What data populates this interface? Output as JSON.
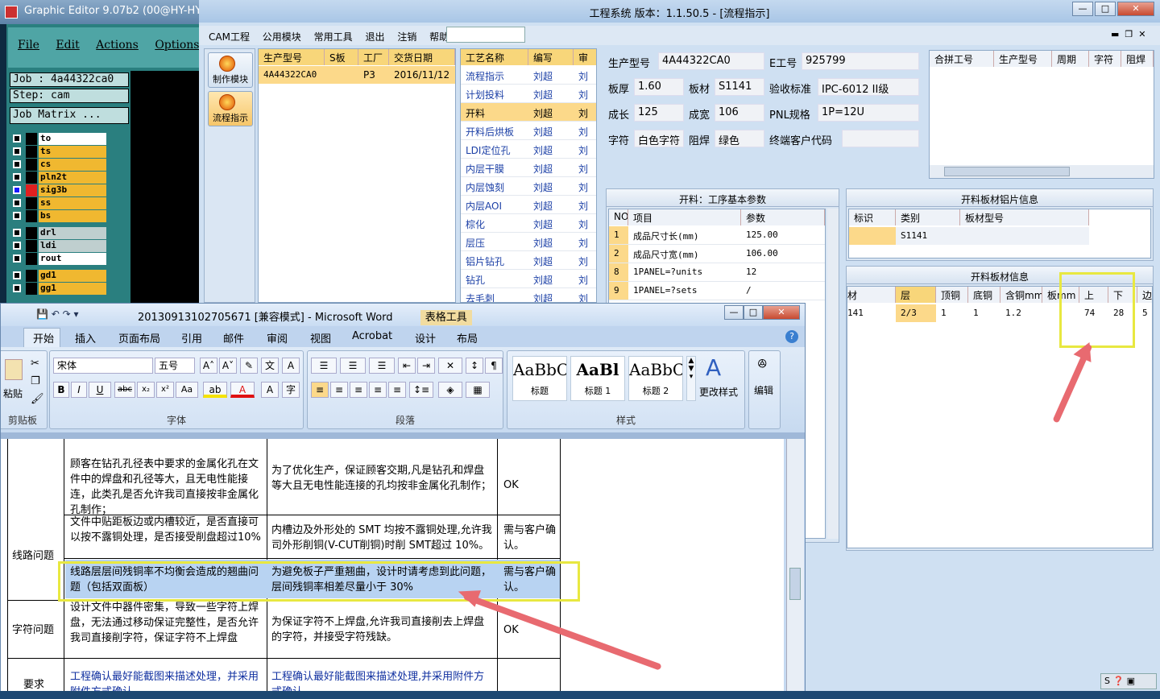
{
  "ge": {
    "title": "Graphic Editor 9.07b2 (00@HY-HYCA",
    "menu": [
      "File",
      "Edit",
      "Actions",
      "Options",
      "A"
    ],
    "job": "Job : 4a44322ca0",
    "step": "Step: cam",
    "matrix": "Job Matrix ...",
    "layers": [
      {
        "name": "to",
        "color": "#ffffff"
      },
      {
        "name": "ts",
        "color": "#f0b830"
      },
      {
        "name": "cs",
        "color": "#f0b830"
      },
      {
        "name": "pln2t",
        "color": "#f0b830"
      },
      {
        "name": "sig3b",
        "color": "#f0b830"
      },
      {
        "name": "ss",
        "color": "#f0b830"
      },
      {
        "name": "bs",
        "color": "#f0b830"
      },
      {
        "name": "drl",
        "color": "#bfcfcf"
      },
      {
        "name": "ldi",
        "color": "#bfcfcf"
      },
      {
        "name": "rout",
        "color": "#ffffff"
      },
      {
        "name": "gd1",
        "color": "#f0b830"
      },
      {
        "name": "gg1",
        "color": "#f0b830"
      }
    ]
  },
  "eng": {
    "title": "工程系统   版本：1.1.50.5 - [流程指示]",
    "menu": [
      "CAM工程",
      "公用模块",
      "常用工具",
      "退出",
      "注销",
      "帮助"
    ],
    "side": [
      "制作模块",
      "流程指示"
    ],
    "orders_headers": [
      "生产型号",
      "S板",
      "工厂",
      "交货日期"
    ],
    "orders_row": [
      "4A44322CA0",
      "",
      "P3",
      "2016/11/12"
    ],
    "process_headers": [
      "工艺名称",
      "编写",
      "审"
    ],
    "process_rows": [
      [
        "流程指示",
        "刘超",
        "刘"
      ],
      [
        "计划投料",
        "刘超",
        "刘"
      ],
      [
        "开料",
        "刘超",
        "刘"
      ],
      [
        "开料后烘板",
        "刘超",
        "刘"
      ],
      [
        "LDI定位孔",
        "刘超",
        "刘"
      ],
      [
        "内层干膜",
        "刘超",
        "刘"
      ],
      [
        "内层蚀刻",
        "刘超",
        "刘"
      ],
      [
        "内层AOI",
        "刘超",
        "刘"
      ],
      [
        "棕化",
        "刘超",
        "刘"
      ],
      [
        "层压",
        "刘超",
        "刘"
      ],
      [
        "铝片钻孔",
        "刘超",
        "刘"
      ],
      [
        "钻孔",
        "刘超",
        "刘"
      ],
      [
        "去毛刺",
        "刘超",
        "刘"
      ]
    ],
    "form": {
      "model_label": "生产型号",
      "model": "4A44322CA0",
      "eno_label": "E工号",
      "eno": "925799",
      "thick_label": "板厚",
      "thick": "1.60",
      "mat_label": "板材",
      "mat": "S1141",
      "std_label": "验收标准",
      "std": "IPC-6012 II级",
      "len_label": "成长",
      "len": "125",
      "wid_label": "成宽",
      "wid": "106",
      "pnl_label": "PNL规格",
      "pnl": "1P=12U",
      "char_label": "字符",
      "char": "白色字符",
      "mask_label": "阻焊",
      "mask": "绿色",
      "cust_label": "终端客户代码",
      "cust": ""
    },
    "merge_headers": [
      "合拼工号",
      "生产型号",
      "周期",
      "字符",
      "阻焊"
    ],
    "params_title": "开料：工序基本参数",
    "params_headers": [
      "NO",
      "项目",
      "参数"
    ],
    "params_rows": [
      [
        "1",
        "成品尺寸长(mm)",
        "125.00"
      ],
      [
        "2",
        "成品尺寸宽(mm)",
        "106.00"
      ],
      [
        "8",
        "1PANEL=?units",
        "12"
      ],
      [
        "9",
        "1PANEL=?sets",
        "/"
      ]
    ],
    "alu_title": "开料板材铝片信息",
    "alu_headers": [
      "标识",
      "类别",
      "板材型号"
    ],
    "alu_row": [
      "",
      "S1141",
      ""
    ],
    "sheet_title": "开料板材信息",
    "sheet_headers": [
      "材",
      "层",
      "顶铜",
      "底铜",
      "含铜mm",
      "板mm",
      "上",
      "下",
      "边"
    ],
    "sheet_row": [
      "141",
      "2/3",
      "1",
      "1",
      "1.2",
      "",
      "74",
      "28",
      "5"
    ]
  },
  "word": {
    "title": "20130913102705671 [兼容模式] - Microsoft Word",
    "table_tools": "表格工具",
    "tabs": [
      "开始",
      "插入",
      "页面布局",
      "引用",
      "邮件",
      "审阅",
      "视图",
      "Acrobat",
      "设计",
      "布局"
    ],
    "groups": [
      "剪贴板",
      "字体",
      "段落",
      "样式",
      "编辑"
    ],
    "paste": "粘贴",
    "font_name": "宋体",
    "font_size": "五号",
    "styles": [
      {
        "sample": "AaBbC",
        "name": "标题"
      },
      {
        "sample": "AaBl",
        "name": "标题 1"
      },
      {
        "sample": "AaBbC",
        "name": "标题 2"
      }
    ],
    "change_style": "更改样式",
    "edit": "编辑",
    "rows": [
      {
        "cat": "",
        "issue": "顾客在钻孔孔径表中要求的金属化孔在文件中的焊盘和孔径等大，且无电性能接连，此类孔是否允许我司直接按非金属化孔制作；",
        "solution": "为了优化生产，保证顾客交期,凡是钻孔和焊盘等大且无电性能连接的孔均按非金属化孔制作；",
        "status": "OK"
      },
      {
        "cat": "线路问题",
        "issue": "文件中贴距板边或内槽较近，是否直接可以按不露铜处理，是否接受削盘超过10%",
        "solution": "内槽边及外形处的 SMT 均按不露铜处理,允许我司外形削铜(V-CUT削铜)时削 SMT超过 10%。",
        "status": "需与客户确认。"
      },
      {
        "cat": "",
        "issue": "线路层层间残铜率不均衡会造成的翘曲问题（包括双面板）",
        "solution": "为避免板子严重翘曲，设计时请考虑到此问题，层间残铜率相差尽量小于 30%",
        "status": "需与客户确认。"
      },
      {
        "cat": "字符问题",
        "issue": "设计文件中器件密集，导致一些字符上焊盘，无法通过移动保证完整性，是否允许我司直接削字符，保证字符不上焊盘",
        "solution": "为保证字符不上焊盘,允许我司直接削去上焊盘的字符，并接受字符残缺。",
        "status": "OK"
      },
      {
        "cat": "要求",
        "issue": "工程确认最好能截图来描述处理，并采用附件方式确认",
        "solution": "工程确认最好能截图来描述处理,并采用附件方式确认",
        "status": ""
      }
    ]
  }
}
